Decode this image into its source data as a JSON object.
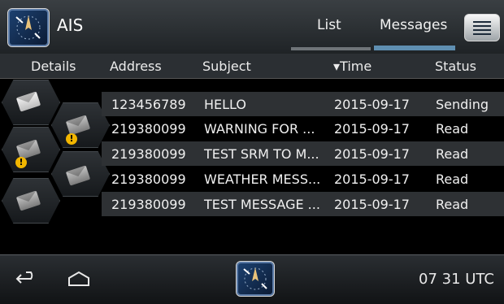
{
  "app": {
    "title": "AIS",
    "icon": "ais-compass-icon"
  },
  "tabs": [
    {
      "label": "List",
      "active": false
    },
    {
      "label": "Messages",
      "active": true
    }
  ],
  "menu_icon": "menu-icon",
  "table": {
    "headers": {
      "details": "Details",
      "address": "Address",
      "subject": "Subject",
      "time": "▾Time",
      "status": "Status"
    },
    "rows": [
      {
        "address": "123456789",
        "subject": "HELLO",
        "time": "2015-09-17",
        "status": "Sending"
      },
      {
        "address": "219380099",
        "subject": "WARNING FOR ...",
        "time": "2015-09-17",
        "status": "Read"
      },
      {
        "address": "219380099",
        "subject": "TEST SRM TO M...",
        "time": "2015-09-17",
        "status": "Read"
      },
      {
        "address": "219380099",
        "subject": "WEATHER MESS...",
        "time": "2015-09-17",
        "status": "Read"
      },
      {
        "address": "219380099",
        "subject": "TEST MESSAGE ...",
        "time": "2015-09-17",
        "status": "Read"
      }
    ]
  },
  "details_icons": [
    {
      "icon": "envelope-open-icon",
      "warning": false
    },
    {
      "icon": "envelope-icon",
      "warning": true
    },
    {
      "icon": "envelope-icon",
      "warning": true
    },
    {
      "icon": "envelope-icon",
      "warning": false
    },
    {
      "icon": "envelope-icon",
      "warning": false
    }
  ],
  "nav": {
    "back_icon": "back-icon",
    "home_icon": "home-icon",
    "app_icon": "ais-compass-icon"
  },
  "status_bar": {
    "clock": "07 31 UTC"
  },
  "colors": {
    "accent": "#5f8fb1",
    "warning": "#f2b600",
    "background": "#000000"
  }
}
